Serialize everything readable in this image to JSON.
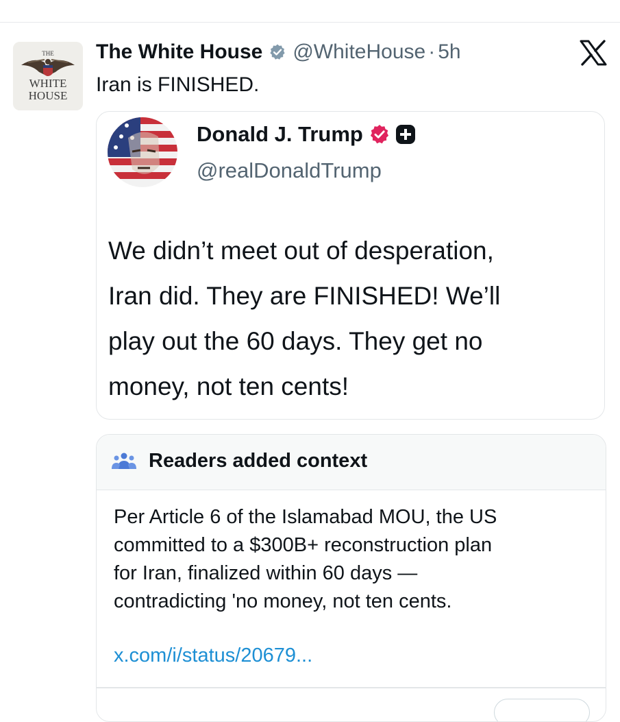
{
  "tweet": {
    "author_name": "The White House",
    "handle": "@WhiteHouse",
    "separator": "·",
    "time": "5h",
    "text": "Iran is FINISHED.",
    "avatar_logo_text": [
      "THE",
      "WHITE",
      "HOUSE"
    ]
  },
  "quoted_post": {
    "author_name": "Donald J. Trump",
    "handle": "@realDonaldTrump",
    "body_lines": [
      "We didn’t meet out of desperation,",
      "Iran did. They are FINISHED! We’ll",
      "play out the 60 days. They get no",
      "money, not ten cents!"
    ]
  },
  "community_note": {
    "title": "Readers added context",
    "body_lines": [
      "Per Article 6 of the Islamabad MOU, the US",
      "committed to a $300B+ reconstruction plan",
      "for Iran, finalized within 60 days —",
      "contradicting 'no money, not ten cents."
    ],
    "link": "x.com/i/status/20679..."
  },
  "colors": {
    "text": "#0f1419",
    "secondary": "#536471",
    "link": "#1d8fd4",
    "verified_grey": "#829aab",
    "verified_red": "#e0245e",
    "border": "#e3e6e8"
  },
  "icons": {
    "verified_grey": "verified-badge-grey-icon",
    "verified_red": "verified-badge-red-icon",
    "plus_badge": "plus-badge-icon",
    "x_logo": "x-logo-icon",
    "people": "people-icon"
  }
}
